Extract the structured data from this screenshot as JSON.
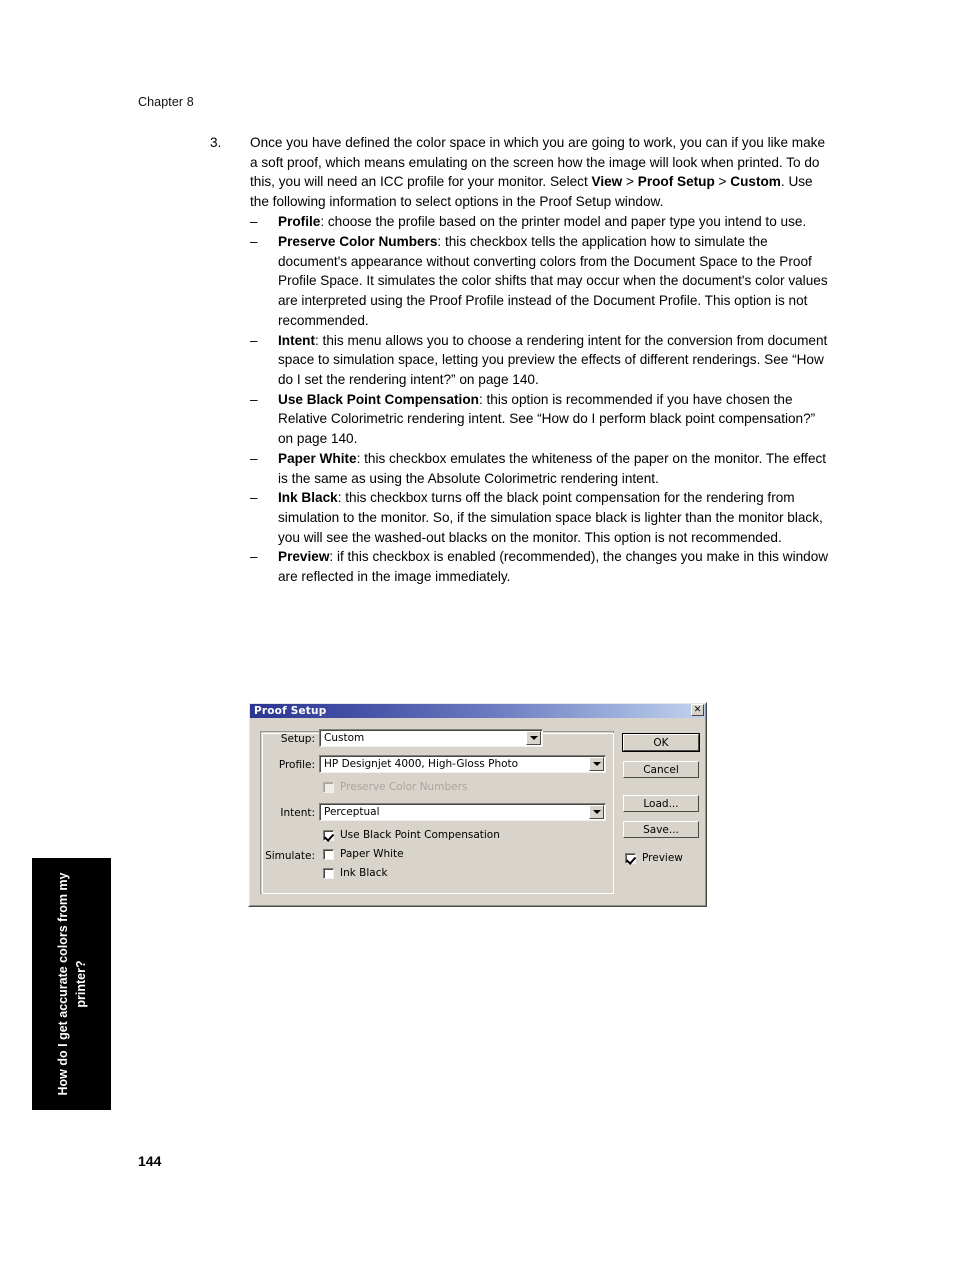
{
  "page": {
    "chapter": "Chapter 8",
    "page_number": "144",
    "side_tab": "How do I get accurate colors from my printer?"
  },
  "body": {
    "numbered_item": {
      "marker": "3.",
      "text_part_1": "Once you have defined the color space in which you are going to work, you can if you like make a soft proof, which means emulating on the screen how the image will look when printed. To do this, you will need an ICC profile for your monitor. Select ",
      "bold_1": "View",
      "sep_1": " > ",
      "bold_2": "Proof Setup",
      "sep_2": " > ",
      "bold_3": "Custom",
      "text_part_2": ". Use the following information to select options in the Proof Setup window."
    },
    "sub_items": [
      {
        "dash": "–",
        "term": "Profile",
        "text": ": choose the profile based on the printer model and paper type you intend to use."
      },
      {
        "dash": "–",
        "term": "Preserve Color Numbers",
        "text": ": this checkbox tells the application how to simulate the document's appearance without converting colors from the Document Space to the Proof Profile Space. It simulates the color shifts that may occur when the document's color values are interpreted using the Proof Profile instead of the Document Profile. This option is not recommended."
      },
      {
        "dash": "–",
        "term": "Intent",
        "text": ": this menu allows you to choose a rendering intent for the conversion from document space to simulation space, letting you preview the effects of different renderings. See “How do I set the rendering intent?” on page 140."
      },
      {
        "dash": "–",
        "term": "Use Black Point Compensation",
        "text": ": this option is recommended if you have chosen the Relative Colorimetric rendering intent. See “How do I perform black point compensation?” on page 140."
      },
      {
        "dash": "–",
        "term": "Paper White",
        "text": ": this checkbox emulates the whiteness of the paper on the monitor. The effect is the same as using the Absolute Colorimetric rendering intent."
      },
      {
        "dash": "–",
        "term": "Ink Black",
        "text": ": this checkbox turns off the black point compensation for the rendering from simulation to the monitor. So, if the simulation space black is lighter than the monitor black, you will see the washed-out blacks on the monitor. This option is not recommended."
      },
      {
        "dash": "–",
        "term": "Preview",
        "text": ": if this checkbox is enabled (recommended), the changes you make in this window are reflected in the image immediately."
      }
    ]
  },
  "dialog": {
    "title": "Proof Setup",
    "close_label": "✕",
    "fields": {
      "setup_label": "Setup:",
      "setup_value": "Custom",
      "profile_label": "Profile:",
      "profile_value": "HP Designjet 4000, High-Gloss Photo",
      "intent_label": "Intent:",
      "intent_value": "Perceptual",
      "simulate_label": "Simulate:"
    },
    "checkboxes": {
      "preserve_color_numbers": "Preserve Color Numbers",
      "use_black_point_compensation": "Use Black Point Compensation",
      "paper_white": "Paper White",
      "ink_black": "Ink Black",
      "preview": "Preview"
    },
    "buttons": {
      "ok": "OK",
      "cancel": "Cancel",
      "load": "Load...",
      "save": "Save..."
    },
    "colors": {
      "titlebar_start": "#2b3590",
      "titlebar_end": "#c3d3ee",
      "face": "#d8d4cc"
    }
  }
}
